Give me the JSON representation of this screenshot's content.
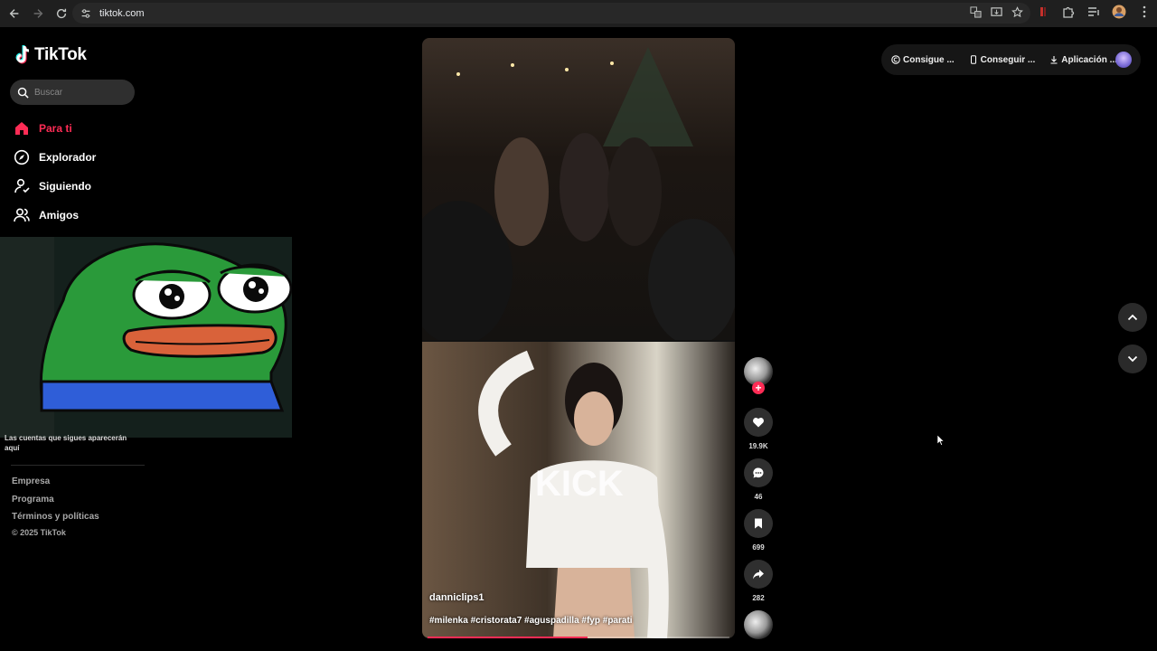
{
  "browser": {
    "url": "tiktok.com"
  },
  "sidebar": {
    "logo": "TikTok",
    "search_placeholder": "Buscar",
    "nav": [
      {
        "label": "Para ti",
        "icon": "home-icon",
        "active": true
      },
      {
        "label": "Explorador",
        "icon": "compass-icon",
        "active": false
      },
      {
        "label": "Siguiendo",
        "icon": "user-follow-icon",
        "active": false
      },
      {
        "label": "Amigos",
        "icon": "friends-icon",
        "active": false
      }
    ],
    "follow_note": "Las cuentas que sigues aparecerán aquí",
    "footer_links": [
      "Empresa",
      "Programa",
      "Términos y políticas"
    ],
    "copyright": "© 2025 TikTok"
  },
  "video": {
    "author": "danniclips1",
    "caption": "#milenka #cristorata7 #aguspadilla #fyp #parati",
    "progress": 0.53
  },
  "actions": {
    "likes": "19.9K",
    "comments": "46",
    "saves": "699",
    "shares": "282"
  },
  "topbar": {
    "pill1": "Consigue ...",
    "pill2": "Conseguir ...",
    "pill3": "Aplicación ..."
  },
  "colors": {
    "accent": "#fe2c55",
    "background": "#000000"
  }
}
